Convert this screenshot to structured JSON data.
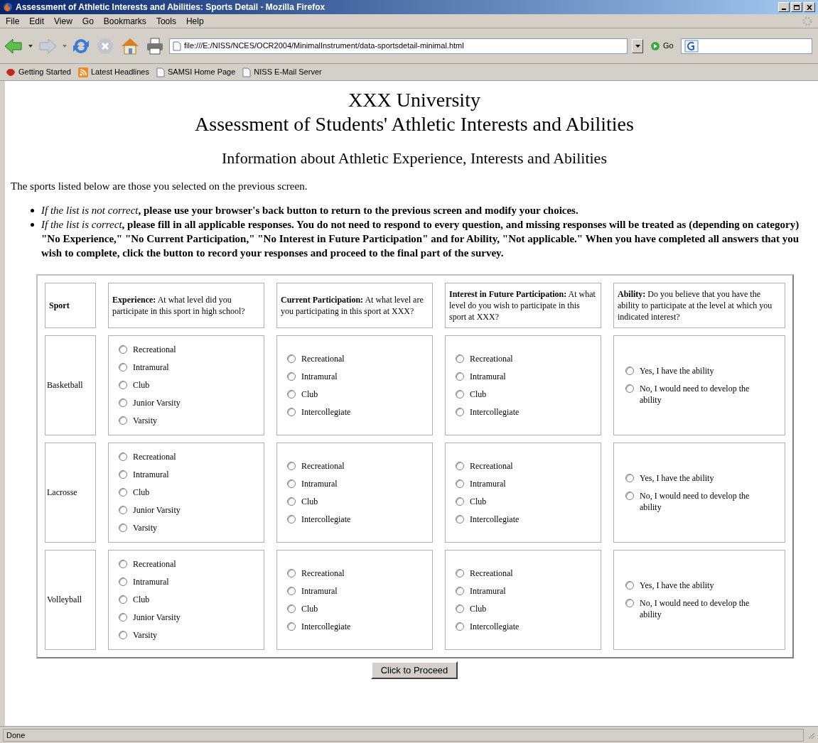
{
  "window": {
    "title": "Assessment of Athletic Interests and Abilities: Sports Detail - Mozilla Firefox"
  },
  "menu": [
    "File",
    "Edit",
    "View",
    "Go",
    "Bookmarks",
    "Tools",
    "Help"
  ],
  "address": {
    "value": "file:///E:/NISS/NCES/OCR2004/MinimalInstrument/data-sportsdetail-minimal.html"
  },
  "go_button": "Go",
  "bookmarks": [
    {
      "label": "Getting Started",
      "kind": "firefox"
    },
    {
      "label": "Latest Headlines",
      "kind": "feed"
    },
    {
      "label": "SAMSI Home Page",
      "kind": "page"
    },
    {
      "label": "NISS E-Mail Server",
      "kind": "page"
    }
  ],
  "page": {
    "headings": [
      "XXX University",
      "Assessment of Students' Athletic Interests and Abilities"
    ],
    "subheading": "Information about Athletic Experience, Interests and Abilities",
    "intro": "The sports listed below are those you selected on the previous screen.",
    "bullets": [
      "*If the list is not correct*, please use your browser's back button to return to the previous screen and modify your choices.",
      "*If the list is correct*, please fill in all applicable responses. You do not need to respond to every question, and missing responses will be treated as (depending on category) \"No Experience,\" \"No Current Participation,\" \"No Interest in Future Participation\" and for Ability, \"Not applicable.\" When you have completed all answers that you wish to complete, click the button to record your responses and proceed to the final part of the survey."
    ]
  },
  "table": {
    "columns": [
      "**Sport**",
      "**Experience:** At what level did you participate in this sport in high school?",
      "**Current Participation:** At what level are you participating in this sport at XXX?",
      "**Interest in Future Participation:** At what level do you wish to participate in this sport at XXX?",
      "**Ability:** Do you believe that you have the ability to participate at the level at which you indicated interest?"
    ],
    "rows": [
      {
        "sport": "Basketball",
        "groups": [
          [
            {
              "label": "Recreational",
              "selected": false
            },
            {
              "label": "Intramural",
              "selected": false
            },
            {
              "label": "Club",
              "selected": false
            },
            {
              "label": "Junior Varsity",
              "selected": false
            },
            {
              "label": "Varsity",
              "selected": false
            }
          ],
          [
            {
              "label": "Recreational",
              "selected": false
            },
            {
              "label": "Intramural",
              "selected": false
            },
            {
              "label": "Club",
              "selected": false
            },
            {
              "label": "Intercollegiate",
              "selected": false
            }
          ],
          [
            {
              "label": "Recreational",
              "selected": false
            },
            {
              "label": "Intramural",
              "selected": false
            },
            {
              "label": "Club",
              "selected": false
            },
            {
              "label": "Intercollegiate",
              "selected": false
            }
          ],
          [
            {
              "label": "Yes, I have the ability",
              "selected": false
            },
            {
              "label": "No, I would need to develop the ability",
              "selected": false
            }
          ]
        ]
      },
      {
        "sport": "Lacrosse",
        "groups": [
          [
            {
              "label": "Recreational",
              "selected": false
            },
            {
              "label": "Intramural",
              "selected": false
            },
            {
              "label": "Club",
              "selected": false
            },
            {
              "label": "Junior Varsity",
              "selected": false
            },
            {
              "label": "Varsity",
              "selected": false
            }
          ],
          [
            {
              "label": "Recreational",
              "selected": false
            },
            {
              "label": "Intramural",
              "selected": false
            },
            {
              "label": "Club",
              "selected": false
            },
            {
              "label": "Intercollegiate",
              "selected": false
            }
          ],
          [
            {
              "label": "Recreational",
              "selected": false
            },
            {
              "label": "Intramural",
              "selected": false
            },
            {
              "label": "Club",
              "selected": false
            },
            {
              "label": "Intercollegiate",
              "selected": false
            }
          ],
          [
            {
              "label": "Yes, I have the ability",
              "selected": false
            },
            {
              "label": "No, I would need to develop the ability",
              "selected": false
            }
          ]
        ]
      },
      {
        "sport": "Volleyball",
        "groups": [
          [
            {
              "label": "Recreational",
              "selected": false
            },
            {
              "label": "Intramural",
              "selected": false
            },
            {
              "label": "Club",
              "selected": false
            },
            {
              "label": "Junior Varsity",
              "selected": false
            },
            {
              "label": "Varsity",
              "selected": false
            }
          ],
          [
            {
              "label": "Recreational",
              "selected": false
            },
            {
              "label": "Intramural",
              "selected": false
            },
            {
              "label": "Club",
              "selected": false
            },
            {
              "label": "Intercollegiate",
              "selected": false
            }
          ],
          [
            {
              "label": "Recreational",
              "selected": false
            },
            {
              "label": "Intramural",
              "selected": false
            },
            {
              "label": "Club",
              "selected": false
            },
            {
              "label": "Intercollegiate",
              "selected": false
            }
          ],
          [
            {
              "label": "Yes, I have the ability",
              "selected": false
            },
            {
              "label": "No, I would need to develop the ability",
              "selected": false
            }
          ]
        ]
      }
    ]
  },
  "proceed_button": "Click to Proceed",
  "status_bar": "Done"
}
